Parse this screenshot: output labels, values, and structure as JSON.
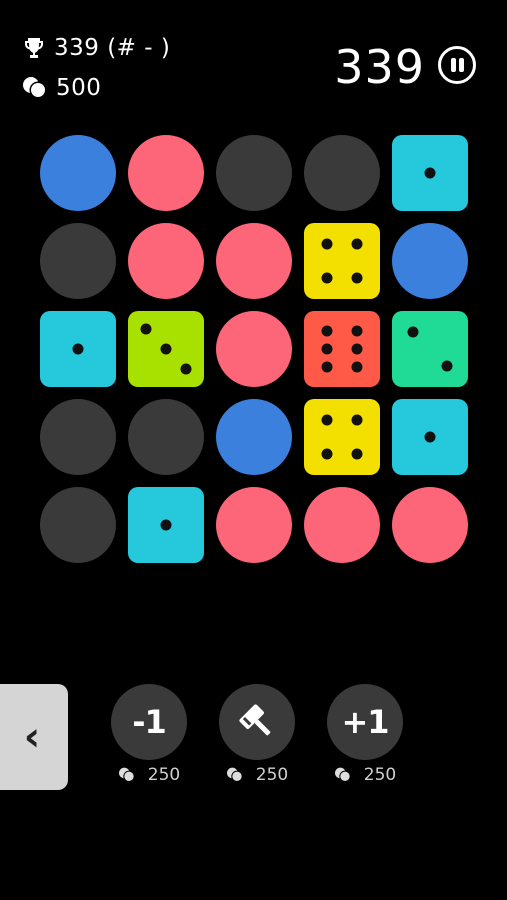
{
  "hud": {
    "best_score": "339 (# - )",
    "coins": "500",
    "score": "339"
  },
  "colors": {
    "background": "#000000",
    "empty": "#3a3a3a",
    "blue": "#3a80dc",
    "pink": "#fd6578",
    "cyan": "#26c8dc",
    "lime": "#a8e000",
    "yellow": "#f3e000",
    "orange": "#ff5a47",
    "green": "#20db96"
  },
  "board": {
    "rows": 5,
    "cols": 5,
    "cells": [
      [
        "blue",
        "pink",
        "empty",
        "empty",
        "cyan-1"
      ],
      [
        "empty",
        "pink",
        "pink",
        "yellow-4",
        "blue"
      ],
      [
        "cyan-1",
        "lime-3",
        "pink",
        "orange-6",
        "green-2"
      ],
      [
        "empty",
        "empty",
        "blue",
        "yellow-4",
        "cyan-1"
      ],
      [
        "empty",
        "cyan-1",
        "pink",
        "pink",
        "pink"
      ]
    ]
  },
  "powerups": [
    {
      "label": "-1",
      "icon": "minus-one",
      "cost": "250"
    },
    {
      "label": "",
      "icon": "hammer-icon",
      "cost": "250"
    },
    {
      "label": "+1",
      "icon": "plus-one",
      "cost": "250"
    }
  ],
  "back_button": {
    "glyph": "‹"
  }
}
